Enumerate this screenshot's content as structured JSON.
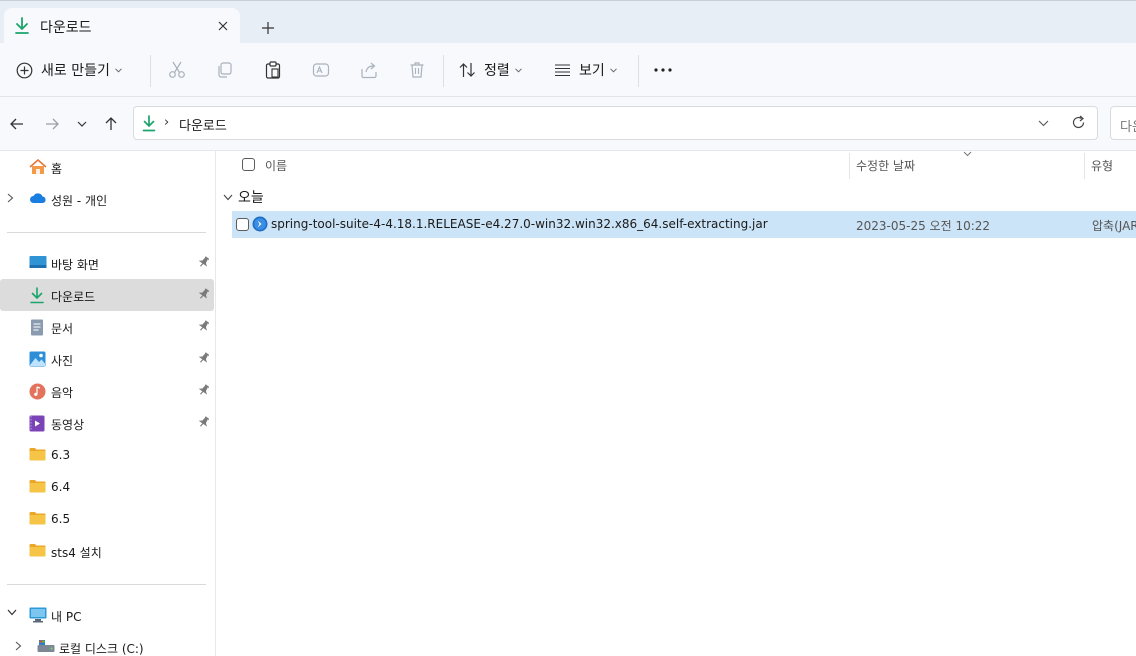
{
  "tab": {
    "title": "다운로드",
    "icon": "download-icon"
  },
  "toolbar": {
    "new_label": "새로 만들기",
    "sort_label": "정렬",
    "view_label": "보기"
  },
  "address": {
    "path": "다운로드",
    "separator": "›",
    "search_placeholder": "다운"
  },
  "sidebar": {
    "top": [
      {
        "label": "홈",
        "icon": "home-icon"
      },
      {
        "label": "성원 - 개인",
        "icon": "onedrive-cloud-icon"
      }
    ],
    "quick_access": [
      {
        "label": "바탕 화면",
        "icon": "desktop-icon",
        "pinned": true
      },
      {
        "label": "다운로드",
        "icon": "download-icon",
        "pinned": true,
        "selected": true
      },
      {
        "label": "문서",
        "icon": "document-icon",
        "pinned": true
      },
      {
        "label": "사진",
        "icon": "pictures-icon",
        "pinned": true
      },
      {
        "label": "음악",
        "icon": "music-icon",
        "pinned": true
      },
      {
        "label": "동영상",
        "icon": "video-icon",
        "pinned": true
      },
      {
        "label": "6.3",
        "icon": "folder-icon"
      },
      {
        "label": "6.4",
        "icon": "folder-icon"
      },
      {
        "label": "6.5",
        "icon": "folder-icon"
      },
      {
        "label": "sts4 설치",
        "icon": "folder-icon"
      }
    ],
    "this_pc": [
      {
        "label": "내 PC",
        "icon": "pc-icon"
      },
      {
        "label": "로컬 디스크 (C:)",
        "icon": "disk-icon"
      }
    ]
  },
  "columns": {
    "name": "이름",
    "modified": "수정한 날짜",
    "type": "유형"
  },
  "group": {
    "label": "오늘"
  },
  "files": [
    {
      "name": "spring-tool-suite-4-4.18.1.RELEASE-e4.27.0-win32.win32.x86_64.self-extracting.jar",
      "modified": "2023-05-25 오전 10:22",
      "type": "압축(JAR)",
      "icon": "jar-archive-icon"
    }
  ],
  "colors": {
    "accent": "#0067c0",
    "download_green": "#1aa56b",
    "selection": "#cce4f7",
    "folder": "#f4c142"
  }
}
